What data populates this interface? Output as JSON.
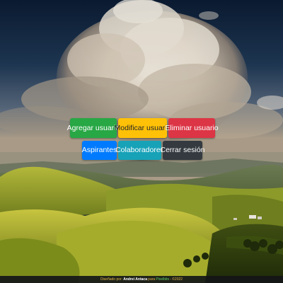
{
  "buttons": {
    "agregar": "Agregar usuario",
    "modificar": "Modificar usuario",
    "eliminar": "Eliminar usuario",
    "aspirantes": "Aspirantes",
    "colaboradores": "Colaboradores",
    "cerrar": "Cerrar sesión"
  },
  "footer": {
    "prefix": "Diseñado por:",
    "author": "Andrei Antaca",
    "connector": "para",
    "brand": "Pixelbits",
    "suffix": "- ©2022"
  },
  "colors": {
    "success": "#28a745",
    "warning": "#ffc107",
    "danger": "#dc3545",
    "primary": "#007bff",
    "info": "#17a2b8",
    "dark": "#343a40"
  }
}
